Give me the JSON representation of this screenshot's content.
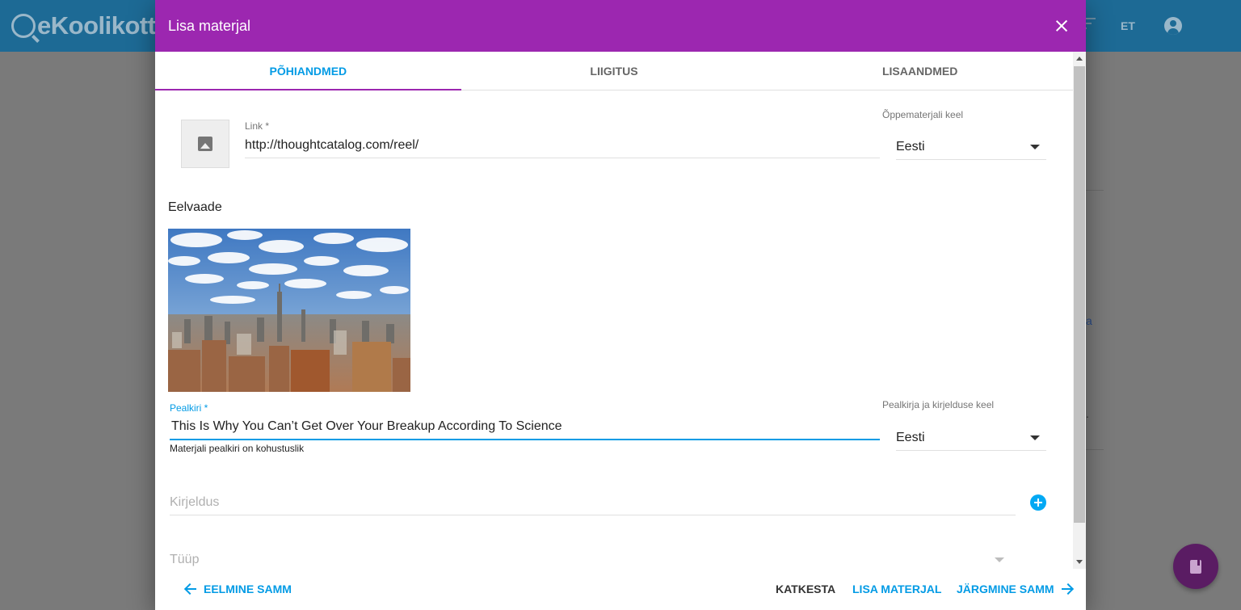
{
  "app": {
    "logo": "eKoolikott",
    "language": "ET",
    "fragment_link": "a",
    "fragment_dot": "."
  },
  "dialog": {
    "title": "Lisa materjal",
    "tabs": [
      {
        "label": "PÕHIANDMED",
        "active": true
      },
      {
        "label": "LIIGITUS",
        "active": false
      },
      {
        "label": "LISAANDMED",
        "active": false
      }
    ],
    "link": {
      "label": "Link *",
      "value": "http://thoughtcatalog.com/reel/"
    },
    "material_language": {
      "label": "Õppematerjali keel",
      "value": "Eesti"
    },
    "preview": {
      "heading": "Eelvaade"
    },
    "title_field": {
      "label": "Pealkiri *",
      "value": "This Is Why You Can’t Get Over Your Breakup According To Science",
      "error": "Materjali pealkiri on kohustuslik"
    },
    "title_language": {
      "label": "Pealkirja ja kirjelduse keel",
      "value": "Eesti"
    },
    "description": {
      "placeholder": "Kirjeldus"
    },
    "type": {
      "placeholder": "Tüüp"
    },
    "footer": {
      "previous": "EELMINE SAMM",
      "cancel": "KATKESTA",
      "add": "LISA MATERJAL",
      "next": "JÄRGMINE SAMM"
    }
  },
  "colors": {
    "header_purple": "#9c27b0",
    "accent_blue": "#039be5",
    "app_header": "#1d6a95"
  }
}
